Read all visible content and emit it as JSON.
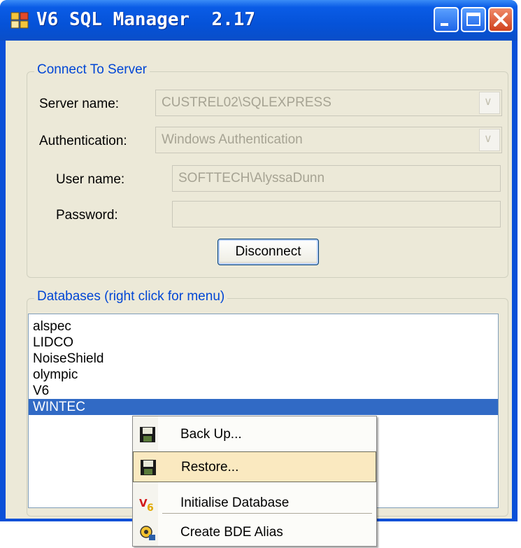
{
  "window": {
    "title": "V6 SQL Manager  2.17",
    "accent": "#0a50d8"
  },
  "connect_group": {
    "title": "Connect To Server",
    "server_name_label": "Server name:",
    "server_name_value": "CUSTREL02\\SQLEXPRESS",
    "authentication_label": "Authentication:",
    "authentication_value": "Windows Authentication",
    "user_name_label": "User name:",
    "user_name_value": "SOFTTECH\\AlyssaDunn",
    "password_label": "Password:",
    "password_value": "",
    "disconnect_label": "Disconnect"
  },
  "databases_group": {
    "title": "Databases (right click for menu)",
    "items": [
      "alspec",
      "LIDCO",
      "NoiseShield",
      "olympic",
      "V6",
      "WINTEC"
    ],
    "selected_index": 5,
    "selected_color": "#316ac5"
  },
  "context_menu": {
    "items": [
      {
        "label": "Back Up...",
        "icon": "floppy-disk-icon"
      },
      {
        "label": "Restore...",
        "icon": "floppy-disk-icon"
      },
      {
        "label": "Initialise Database",
        "icon": "v6-logo-icon"
      },
      {
        "label": "Create BDE Alias",
        "icon": "bde-config-icon"
      }
    ],
    "highlighted_index": 1,
    "highlight_color": "#fae9c0"
  }
}
